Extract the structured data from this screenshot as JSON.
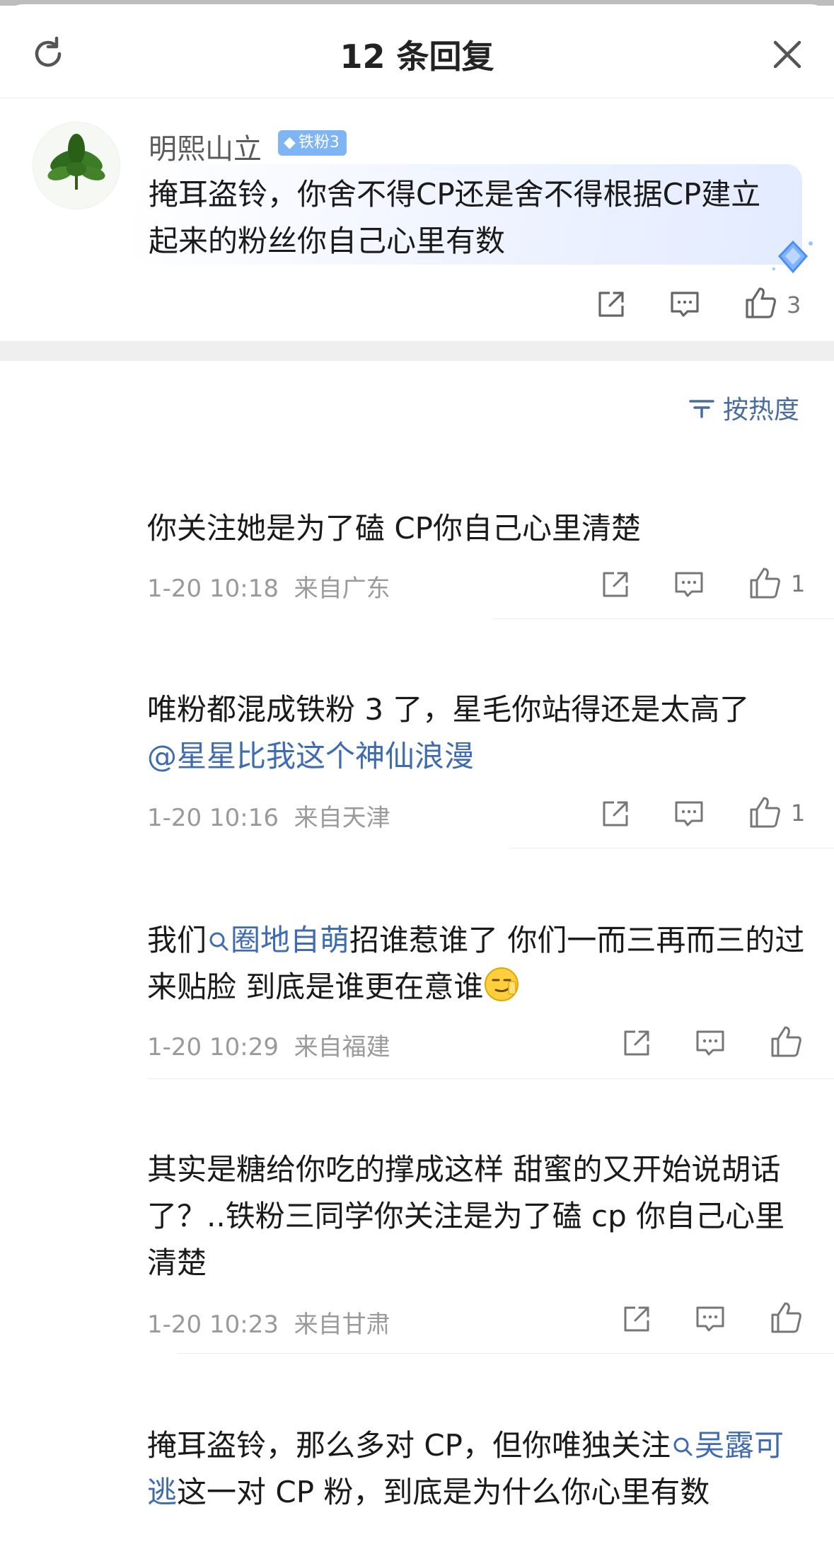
{
  "header": {
    "title": "12 条回复",
    "refresh_icon": "refresh-icon",
    "close_icon": "close-icon"
  },
  "main_comment": {
    "username": "明熙山立",
    "badge": "铁粉3",
    "text": "掩耳盗铃，你舍不得CP还是舍不得根据CP建立起来的粉丝你自己心里有数",
    "likes": "3"
  },
  "sort": {
    "label": "按热度"
  },
  "replies": [
    {
      "text": "你关注她是为了磕 CP你自己心里清楚",
      "time": "1-20 10:18",
      "location": "来自广东",
      "likes": "1"
    },
    {
      "text": "唯粉都混成铁粉 3 了，星毛你站得还是太高了",
      "mention": "@星星比我这个神仙浪漫",
      "time": "1-20 10:16",
      "location": "来自天津",
      "likes": "1"
    },
    {
      "text_pre": "我们",
      "topic": "圈地自萌",
      "text_post": "招谁惹谁了 你们一而三再而三的过来贴脸 到底是谁更在意谁",
      "time": "1-20 10:29",
      "location": "来自福建",
      "likes": ""
    },
    {
      "text": "其实是糖给你吃的撑成这样 甜蜜的又开始说胡话了？..铁粉三同学你关注是为了磕 cp 你自己心里清楚",
      "time": "1-20 10:23",
      "location": "来自甘肃",
      "likes": ""
    },
    {
      "text_pre": "掩耳盗铃，那么多对 CP，但你唯独关注",
      "topic": "吴露可逃",
      "text_post": "这一对 CP 粉，到底是为什么你心里有数"
    }
  ]
}
